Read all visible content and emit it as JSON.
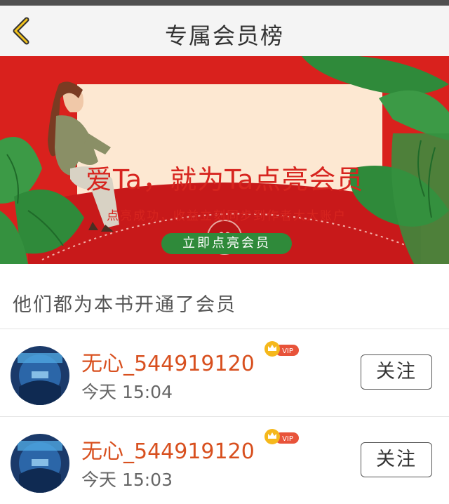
{
  "header": {
    "title": "专属会员榜"
  },
  "banner": {
    "title": "爱Ta，就为Ta点亮会员",
    "subtitle": "点亮成功，收益立刻同步到作者大大账户",
    "button_label": "立即点亮会员"
  },
  "section": {
    "title": "他们都为本书开通了会员"
  },
  "members": [
    {
      "name": "无心_544919120",
      "badge": "VIP",
      "time": "今天 15:04",
      "follow_label": "关注"
    },
    {
      "name": "无心_544919120",
      "badge": "VIP",
      "time": "今天 15:03",
      "follow_label": "关注"
    }
  ],
  "colors": {
    "accent": "#d8501f",
    "banner_bg": "#d9211d",
    "button_green": "#2f8a3a"
  }
}
